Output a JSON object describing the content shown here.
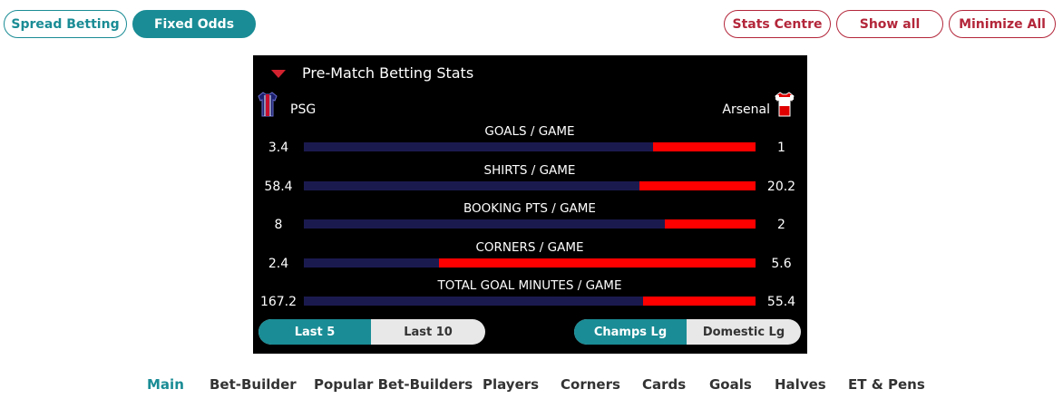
{
  "top_left": {
    "spread_betting": "Spread Betting",
    "fixed_odds": "Fixed Odds"
  },
  "top_right": {
    "stats_centre": "Stats Centre",
    "show_all": "Show all",
    "minimize_all": "Minimize All"
  },
  "panel": {
    "title": "Pre-Match Betting Stats",
    "home_team": "PSG",
    "away_team": "Arsenal",
    "stats": [
      {
        "label": "GOALS / GAME",
        "home": "3.4",
        "away": "1"
      },
      {
        "label": "SHIRTS / GAME",
        "home": "58.4",
        "away": "20.2"
      },
      {
        "label": "BOOKING PTS / GAME",
        "home": "8",
        "away": "2"
      },
      {
        "label": "CORNERS / GAME",
        "home": "2.4",
        "away": "5.6"
      },
      {
        "label": "TOTAL GOAL MINUTES / GAME",
        "home": "167.2",
        "away": "55.4"
      }
    ],
    "range_toggle": {
      "last5": "Last 5",
      "last10": "Last 10",
      "selected": "Last 5"
    },
    "comp_toggle": {
      "champs": "Champs Lg",
      "domestic": "Domestic Lg",
      "selected": "Champs Lg"
    }
  },
  "tabs": [
    "Main",
    "Bet-Builder",
    "Popular Bet-Builders",
    "Players",
    "Corners",
    "Cards",
    "Goals",
    "Halves",
    "ET & Pens"
  ],
  "active_tab": "Main",
  "colors": {
    "teal": "#1a8c95",
    "red_outline": "#b3263a",
    "home_bar": "#1b1a4f",
    "away_bar": "#ff0000"
  },
  "icons": {
    "caret": "caret-down-icon",
    "home_shirt": "psg-shirt-icon",
    "away_shirt": "arsenal-shirt-icon"
  }
}
